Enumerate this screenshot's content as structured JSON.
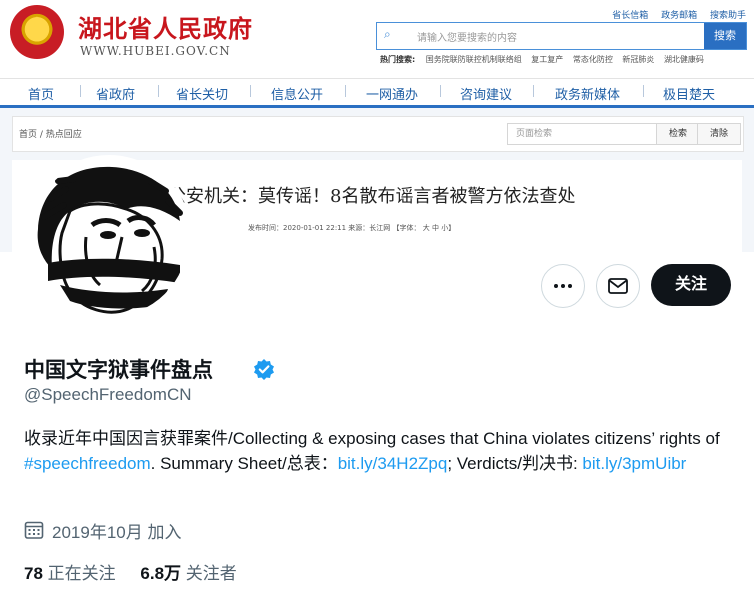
{
  "gov": {
    "title": "湖北省人民政府",
    "url": "WWW.HUBEI.GOV.CN",
    "top_links": [
      "省长信箱",
      "政务邮箱",
      "搜索助手"
    ],
    "search_placeholder": "请输入您要搜索的内容",
    "search_button": "搜索",
    "hot_label": "热门搜索:",
    "hot_items": [
      "国务院联防联控机制联络组",
      "复工复产",
      "常态化防控",
      "新冠肺炎",
      "湖北健康码"
    ],
    "nav": [
      "首页",
      "省政府",
      "省长关切",
      "信息公开",
      "一网通办",
      "咨询建议",
      "政务新媒体",
      "极目楚天"
    ],
    "breadcrumb": [
      "首页",
      "热点回应"
    ],
    "page_search_placeholder": "页面检索",
    "page_search_button": "检索",
    "clear_button": "清除",
    "headline": "公安机关：莫传谣！8名散布谣言者被警方依法查处",
    "meta": "发布时间：2020-01-01 22:11   来源：长江网    【字体： 大  中  小】"
  },
  "profile": {
    "name": "中国文字狱事件盘点",
    "handle": "@SpeechFreedomCN",
    "bio": {
      "text1": "收录近年中国因言获罪案件/Collecting & exposing cases that China violates citizens’ rights of ",
      "hashtag": "#speechfreedom",
      "text2": ". Summary Sheet/总表：",
      "link1": "bit.ly/34H2Zpq",
      "text3": "; Verdicts/判决书: ",
      "link2": "bit.ly/3pmUibr"
    },
    "joined": "2019年10月 加入",
    "following_count": "78",
    "following_label": "正在关注",
    "followers_count": "6.8万",
    "followers_label": "关注者",
    "follow_button": "关注",
    "more_icon": "more-icon",
    "message_icon": "envelope-icon",
    "link_color": "#1d9bf0",
    "verified_color": "#1d9bf0"
  }
}
